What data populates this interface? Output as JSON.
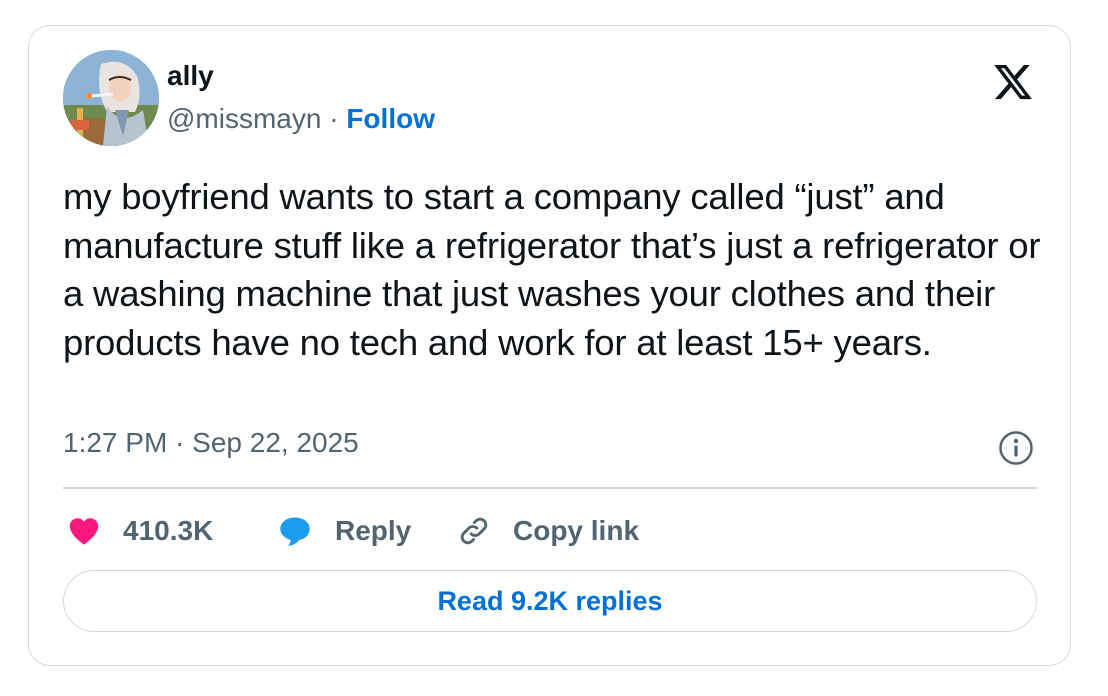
{
  "author": {
    "display_name": "ally",
    "handle": "@missmayn",
    "separator": "·",
    "follow_label": "Follow"
  },
  "tweet": {
    "text": "my boyfriend wants to start a company called “just” and manufacture stuff like a refrigerator that’s just a refrigerator or a washing machine that just washes your clothes and their products have no tech and work for at least 15+ years.",
    "timestamp": "1:27 PM · Sep 22, 2025"
  },
  "actions": {
    "likes": "410.3K",
    "reply_label": "Reply",
    "copy_link_label": "Copy link"
  },
  "read_replies_label": "Read 9.2K replies",
  "icons": {
    "brand": "x-logo-icon",
    "info": "info-icon",
    "like": "heart-icon",
    "reply": "speech-bubble-icon",
    "copy": "link-icon"
  },
  "colors": {
    "text": "#0f1419",
    "secondary": "#536471",
    "link": "#006fd6",
    "heart": "#f91880",
    "bubble": "#1d9bf0",
    "border": "#cfd9de"
  }
}
